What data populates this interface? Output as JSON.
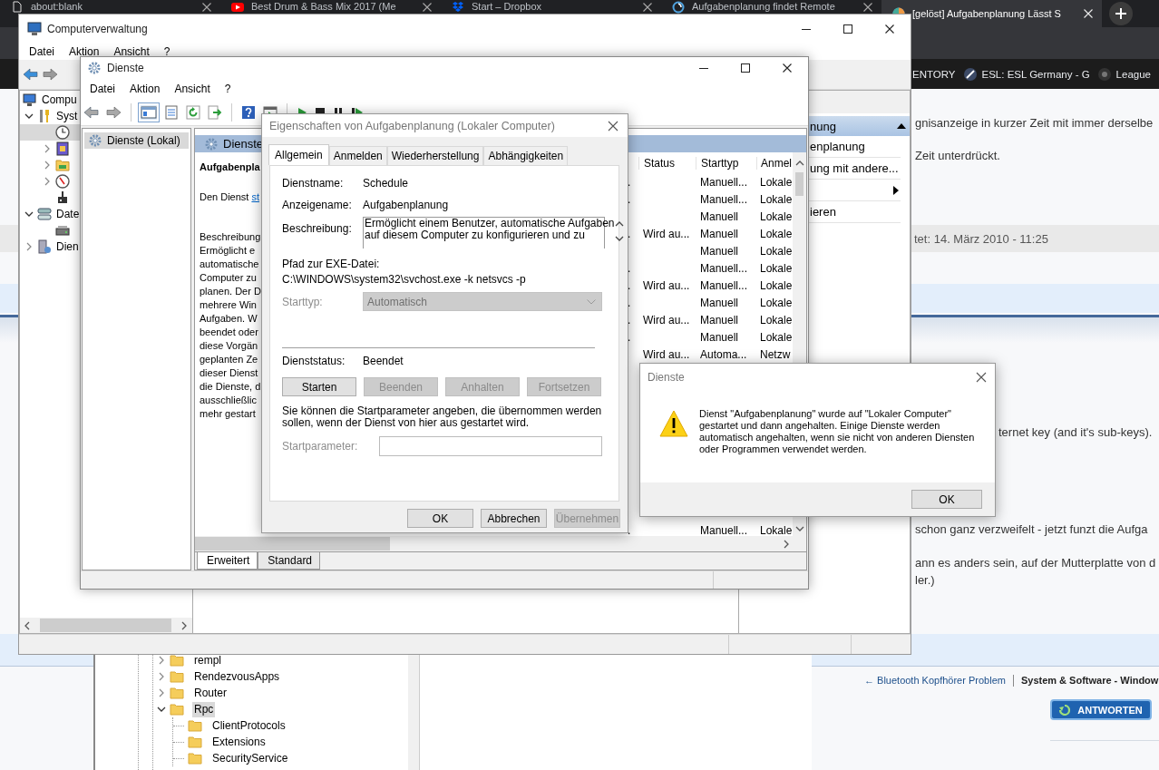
{
  "browser": {
    "tabs": [
      {
        "title": "about:blank",
        "selected": false
      },
      {
        "title": "Best Drum & Bass Mix 2017 (Me",
        "selected": false
      },
      {
        "title": "Start – Dropbox",
        "selected": false
      },
      {
        "title": "Aufgabenplanung findet Remote",
        "selected": false
      },
      {
        "title": "[gelöst] Aufgabenplanung Lässt S",
        "selected": true
      }
    ],
    "bookmarks": [
      "ENTORY",
      "ESL: ESL Germany - G",
      "League"
    ],
    "page": {
      "intro_lines": [
        "gnisanzeige in kurzer Zeit mit immer derselbe",
        "Zeit unterdrückt."
      ],
      "post_date": "tet: 14. März 2010 - 11:25",
      "quote_line": "ternet key (and it's sub-keys).",
      "reply_line": "schon ganz verzweifelt - jetzt funzt die Aufga",
      "closing_lines": [
        "ann es anders sein, auf der Mutterplatte von d",
        "ler.)"
      ],
      "previous_thread_link": "← Bluetooth Kopfhörer Problem",
      "forum_link": "System & Software - Window",
      "reply_button": "ANTWORTEN"
    }
  },
  "registry_editor": {
    "tree": [
      {
        "label": "rempl",
        "expanded": false,
        "selected": false
      },
      {
        "label": "RendezvousApps",
        "expanded": false,
        "selected": false
      },
      {
        "label": "Router",
        "expanded": false,
        "selected": false
      },
      {
        "label": "Rpc",
        "expanded": true,
        "selected": true,
        "children": [
          {
            "label": "ClientProtocols",
            "selected": false
          },
          {
            "label": "Extensions",
            "selected": false
          },
          {
            "label": "SecurityService",
            "selected": false
          }
        ]
      }
    ]
  },
  "computer_management": {
    "title": "Computerverwaltung",
    "menu": [
      "Datei",
      "Aktion",
      "Ansicht",
      "?"
    ],
    "tree": [
      {
        "label": "Compu",
        "kind": "computer",
        "selected": false,
        "children": [
          {
            "label": "Syst",
            "kind": "tools",
            "expanded": true,
            "selected": false,
            "children": [
              {
                "kind": "clock",
                "selected": true
              },
              {
                "kind": "book",
                "expanded": false,
                "selected": false
              },
              {
                "kind": "folder",
                "expanded": false,
                "selected": false
              },
              {
                "kind": "gauge",
                "expanded": false,
                "selected": false
              },
              {
                "kind": "plug",
                "selected": false
              }
            ]
          },
          {
            "label": "Date",
            "kind": "storage",
            "expanded": true,
            "selected": false,
            "children": [
              {
                "kind": "drive",
                "selected": false
              }
            ]
          },
          {
            "label": "Dien",
            "kind": "server",
            "expanded": false,
            "selected": false
          }
        ]
      }
    ],
    "actions": {
      "header": "nung",
      "items": [
        {
          "kind": "text",
          "label": "enplanung"
        },
        {
          "kind": "text",
          "label": "ung mit andere..."
        },
        {
          "kind": "submenu"
        },
        {
          "kind": "text",
          "label": "ieren"
        }
      ]
    }
  },
  "services_window": {
    "title": "Dienste",
    "menu": [
      "Datei",
      "Aktion",
      "Ansicht",
      "?"
    ],
    "tree": [
      {
        "label": "Dienste (Lokal)",
        "selected": true
      }
    ],
    "header": "Dienste",
    "detail": {
      "title": "Aufgabenpla",
      "action_prefix": "Den Dienst",
      "action_link": "st",
      "description_label": "Beschreibung",
      "description_lines": [
        "Ermöglicht e",
        "automatische",
        "Computer zu",
        "planen. Der D",
        "mehrere Win",
        "Aufgaben. W",
        "beendet oder",
        "diese Vorgän",
        "geplanten Ze",
        "dieser Dienst",
        "die Dienste, d",
        "ausschließlic",
        "mehr gestart"
      ]
    },
    "columns": [
      "Status",
      "Starttyp",
      "Anmel"
    ],
    "rows": [
      {
        "column_1": ".",
        "start_type": "Manuell...",
        "logon": "Lokale"
      },
      {
        "column_1": ".",
        "start_type": "Manuell...",
        "logon": "Lokale"
      },
      {
        "start_type": "Manuell",
        "logon": "Lokale"
      },
      {
        "column_1": ".",
        "status": "Wird au...",
        "start_type": "Manuell",
        "logon": "Lokale"
      },
      {
        "start_type": "Manuell",
        "logon": "Lokale"
      },
      {
        "column_1": ".",
        "start_type": "Manuell...",
        "logon": "Lokale"
      },
      {
        "column_1": ".",
        "status": "Wird au...",
        "start_type": "Manuell...",
        "logon": "Lokale"
      },
      {
        "column_1": ".",
        "start_type": "Manuell",
        "logon": "Lokale"
      },
      {
        "column_1": ".",
        "status": "Wird au...",
        "start_type": "Manuell",
        "logon": "Lokale"
      },
      {
        "column_1": ".",
        "start_type": "Manuell",
        "logon": "Lokale"
      },
      {
        "status": "Wird au...",
        "start_type": "Automa...",
        "logon": "Netzw"
      }
    ],
    "rows_below_message": [
      {
        "column_1": ".",
        "start_type": "Manuell...",
        "logon": "Lokale"
      }
    ],
    "view_tabs": [
      {
        "label": "Erweitert",
        "selected": true
      },
      {
        "label": "Standard",
        "selected": false
      }
    ]
  },
  "properties_dialog": {
    "title": "Eigenschaften von Aufgabenplanung (Lokaler Computer)",
    "tabs": [
      {
        "label": "Allgemein",
        "selected": true
      },
      {
        "label": "Anmelden",
        "selected": false
      },
      {
        "label": "Wiederherstellung",
        "selected": false
      },
      {
        "label": "Abhängigkeiten",
        "selected": false
      }
    ],
    "service_name_label": "Dienstname:",
    "service_name": "Schedule",
    "display_name_label": "Anzeigename:",
    "display_name": "Aufgabenplanung",
    "description_label": "Beschreibung:",
    "description_lines": [
      "Ermöglicht einem Benutzer, automatische Aufgaben",
      "auf diesem Computer zu konfigurieren und zu"
    ],
    "path_label": "Pfad zur EXE-Datei:",
    "path": "C:\\WINDOWS\\system32\\svchost.exe -k netsvcs -p",
    "startup_type_label": "Starttyp:",
    "startup_type": "Automatisch",
    "startup_type_disabled": true,
    "status_label": "Dienststatus:",
    "status": "Beendet",
    "control_buttons": [
      {
        "label": "Starten",
        "disabled": false
      },
      {
        "label": "Beenden",
        "disabled": true
      },
      {
        "label": "Anhalten",
        "disabled": true
      },
      {
        "label": "Fortsetzen",
        "disabled": true
      }
    ],
    "hint": "Sie können die Startparameter angeben, die übernommen werden sollen, wenn der Dienst von hier aus gestartet wird.",
    "start_parameter_label": "Startparameter:",
    "start_parameter_disabled": true,
    "buttons": [
      {
        "label": "OK",
        "disabled": false
      },
      {
        "label": "Abbrechen",
        "disabled": false
      },
      {
        "label": "Übernehmen",
        "disabled": true
      }
    ]
  },
  "message_box": {
    "title": "Dienste",
    "message": "Dienst \"Aufgabenplanung\" wurde auf \"Lokaler Computer\" gestartet und dann angehalten. Einige Dienste werden automatisch angehalten, wenn sie nicht von anderen Diensten oder Programmen verwendet werden.",
    "button": "OK"
  }
}
